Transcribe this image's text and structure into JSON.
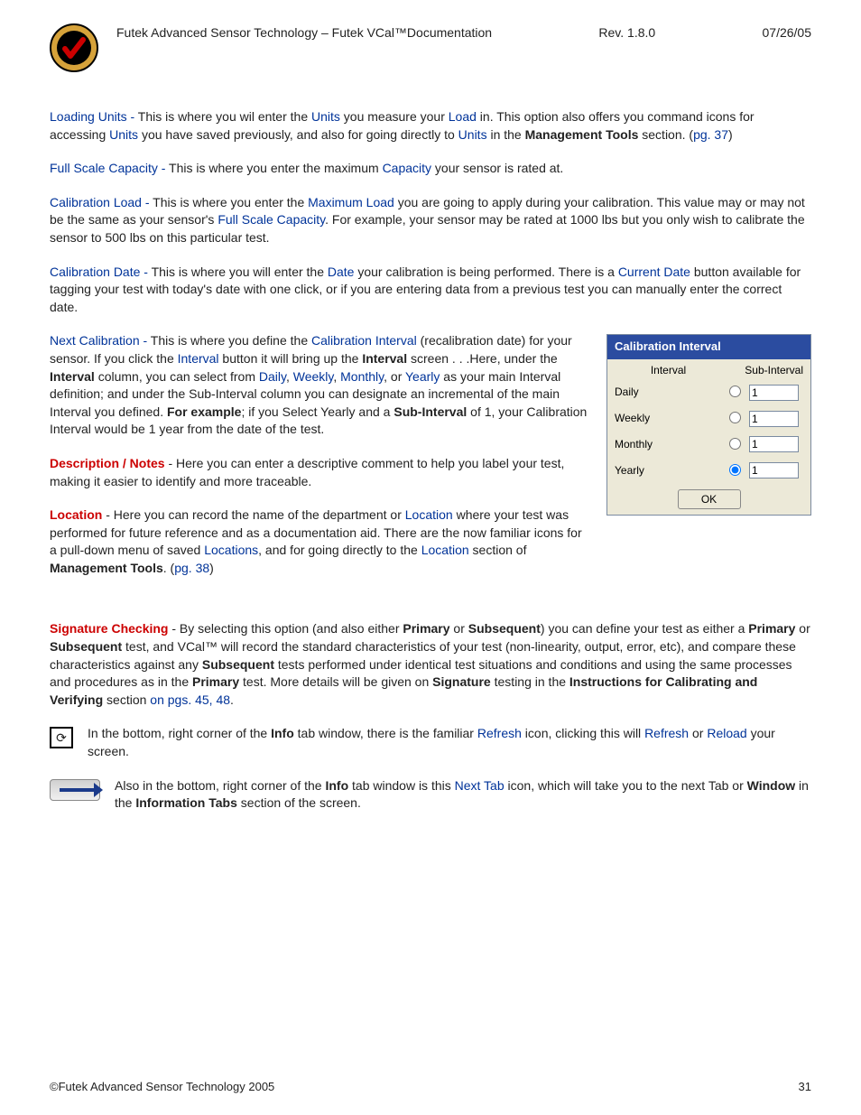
{
  "header": {
    "title": "Futek Advanced Sensor Technology – Futek VCal™Documentation",
    "revision": "Rev. 1.8.0",
    "date": "07/26/05"
  },
  "links": {
    "loading_units": "Loading Units -",
    "units": "Units",
    "load": "Load",
    "pg37": "pg. 37",
    "full_scale_capacity": "Full Scale Capacity -",
    "capacity": "Capacity",
    "calibration_load": "Calibration Load -",
    "maximum_load": "Maximum Load",
    "full_scale_capacity2": "Full Scale Capacity",
    "calibration_date": "Calibration Date -",
    "date": "Date",
    "current_date": "Current Date",
    "next_calibration": "Next Calibration -",
    "calibration_interval": "Calibration Interval",
    "interval": "Interval",
    "daily": "Daily",
    "weekly": "Weekly",
    "monthly": "Monthly",
    "yearly": "Yearly",
    "location_link": "Location",
    "locations": "Locations",
    "pg38": "pg. 38",
    "on_pgs": "on pgs. 45, 48",
    "refresh": "Refresh",
    "reload": "Reload",
    "next_tab": "Next Tab"
  },
  "bold": {
    "management_tools": "Management Tools",
    "interval_b": "Interval",
    "for_example": "For example",
    "sub_interval_b": "Sub-Interval",
    "desc_notes": "Description / Notes",
    "location_b": "Location",
    "signature_checking": "Signature Checking",
    "primary": "Primary",
    "subsequent": "Subsequent",
    "signature": "Signature",
    "instructions": "Instructions for Calibrating and Verifying",
    "info": "Info",
    "window": "Window",
    "information_tabs": "Information Tabs"
  },
  "text": {
    "p1_a": " This is where you wil enter the ",
    "p1_b": " you measure your ",
    "p1_c": " in. This option also offers you command icons for accessing ",
    "p1_d": " you have saved previously, and also for going directly to ",
    "p1_e": " in the ",
    "p1_f": " section. (",
    "p1_g": ")",
    "p2_a": " This is where you enter the maximum ",
    "p2_b": " your sensor is rated at.",
    "p3_a": " This is where you enter the ",
    "p3_b": " you are going to apply during your calibration. This value may or may not be the same as your sensor's ",
    "p3_c": ". For example, your sensor may be rated at 1000 lbs but you only wish to calibrate the sensor to 500 lbs on this particular test.",
    "p4_a": " This is where you will enter the ",
    "p4_b": " your calibration is being performed. There is a ",
    "p4_c": " button available for tagging your test with today's date with one click, or if you are entering data from a previous test you can manually enter the correct date.",
    "p5_a": " This is where you define the ",
    "p5_b": " (recalibration date) for your sensor. If you click the ",
    "p5_c": " button it will bring up the ",
    "p5_d": " screen . . .Here, under the ",
    "p5_e": " column, you can select from ",
    "p5_comma": ", ",
    "p5_or": ", or ",
    "p5_f": " as your main Interval definition; and under the Sub-Interval column you can designate an incremental of the main Interval you defined. ",
    "p5_g": "; if you Select Yearly and a ",
    "p5_h": " of 1, your Calibration Interval would be 1 year from the date of the test.",
    "p6_a": " - Here you can enter a descriptive comment to help you label your test, making it easier to identify and more traceable.",
    "p7_a": " - Here you can record the name of the department or ",
    "p7_b": " where your test was performed for future reference and as a documentation aid. There are the now familiar icons for a pull-down menu of saved ",
    "p7_c": ", and for going directly to the ",
    "p7_d": " section of ",
    "p7_e": ". (",
    "p7_f": ")",
    "p8_a": " - By selecting this option (and also either ",
    "p8_b": " or ",
    "p8_c": ") you can define your test as either a ",
    "p8_d": " or ",
    "p8_e": " test, and VCal™ will record the standard characteristics of your test (non-linearity, output, error, etc), and compare these characteristics against any ",
    "p8_f": " tests performed under identical test situations and conditions and using the same processes and procedures as in the ",
    "p8_g": " test. More details will be given on ",
    "p8_h": " testing in the ",
    "p8_i": " section ",
    "p8_j": ".",
    "p9_a": "In the bottom, right corner of the ",
    "p9_b": " tab window, there is the familiar ",
    "p9_c": " icon, clicking this will ",
    "p9_d": " or ",
    "p9_e": " your screen.",
    "p10_a": "Also in the bottom, right corner of the ",
    "p10_b": " tab window is this ",
    "p10_c": " icon, which will take you to the next Tab or ",
    "p10_d": " in the ",
    "p10_e": " section of the screen."
  },
  "interval_box": {
    "title": "Calibration Interval",
    "col_interval": "Interval",
    "col_sub": "Sub-Interval",
    "rows": [
      {
        "label": "Daily",
        "selected": false,
        "value": "1"
      },
      {
        "label": "Weekly",
        "selected": false,
        "value": "1"
      },
      {
        "label": "Monthly",
        "selected": false,
        "value": "1"
      },
      {
        "label": "Yearly",
        "selected": true,
        "value": "1"
      }
    ],
    "ok": "OK"
  },
  "footer": {
    "copyright": "©Futek Advanced Sensor Technology 2005",
    "page": "31"
  }
}
